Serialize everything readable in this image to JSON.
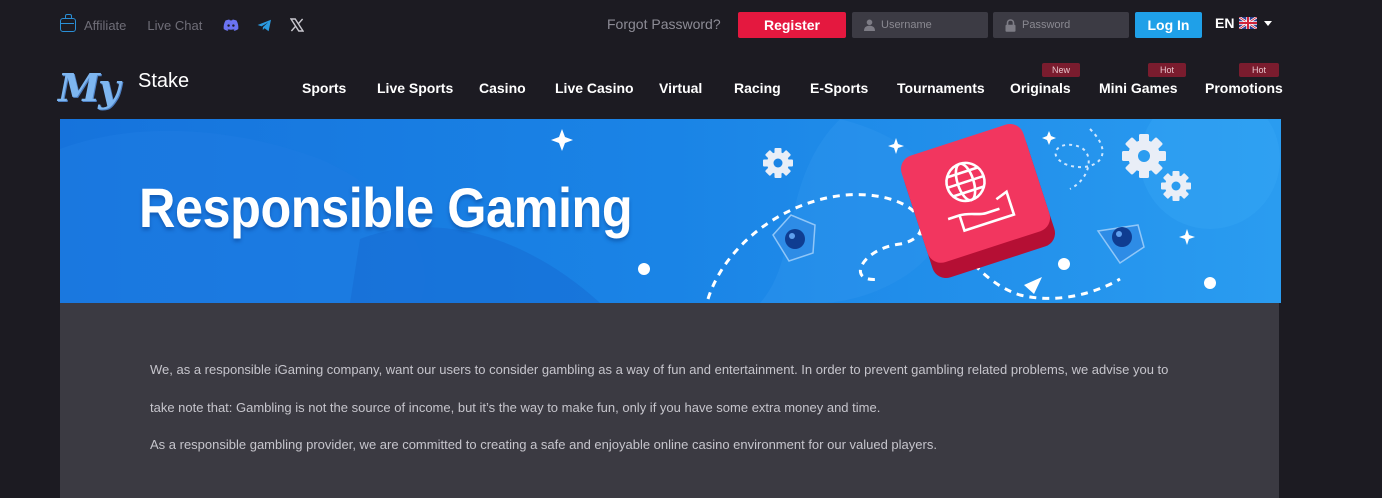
{
  "topbar": {
    "affiliate_label": "Affiliate",
    "live_chat_label": "Live Chat",
    "social_icons": [
      "discord-icon",
      "telegram-icon",
      "x-icon"
    ],
    "forgot_password": "Forgot Password?",
    "register_label": "Register",
    "username_placeholder": "Username",
    "password_placeholder": "Password",
    "login_label": "Log In",
    "language": "EN"
  },
  "logo": {
    "part1": "My",
    "part2": "Stake"
  },
  "nav": {
    "items": [
      {
        "label": "Sports"
      },
      {
        "label": "Live Sports"
      },
      {
        "label": "Casino"
      },
      {
        "label": "Live Casino"
      },
      {
        "label": "Virtual"
      },
      {
        "label": "Racing"
      },
      {
        "label": "E-Sports"
      },
      {
        "label": "Tournaments"
      },
      {
        "label": "Originals",
        "badge": "New"
      },
      {
        "label": "Mini Games",
        "badge": "Hot"
      },
      {
        "label": "Promotions",
        "badge": "Hot"
      }
    ]
  },
  "banner": {
    "title": "Responsible Gaming"
  },
  "content": {
    "paragraph1_line1": "We, as a responsible iGaming company, want our users to consider gambling as a way of fun and entertainment.  In order to prevent gambling related problems, we advise you to",
    "paragraph1_line2": "take note that: Gambling is not the source of income, but it’s the way to make fun, only if you have some extra money and time.",
    "paragraph2": "As a responsible gambling provider, we are committed to creating a safe and enjoyable online casino environment for our valued players."
  },
  "colors": {
    "background": "#1c1b22",
    "register": "#e4183f",
    "login": "#1fa0e8",
    "banner_blue": "#1a84e6",
    "badge": "#7a1c2e",
    "content_bg": "#3b3a42"
  }
}
